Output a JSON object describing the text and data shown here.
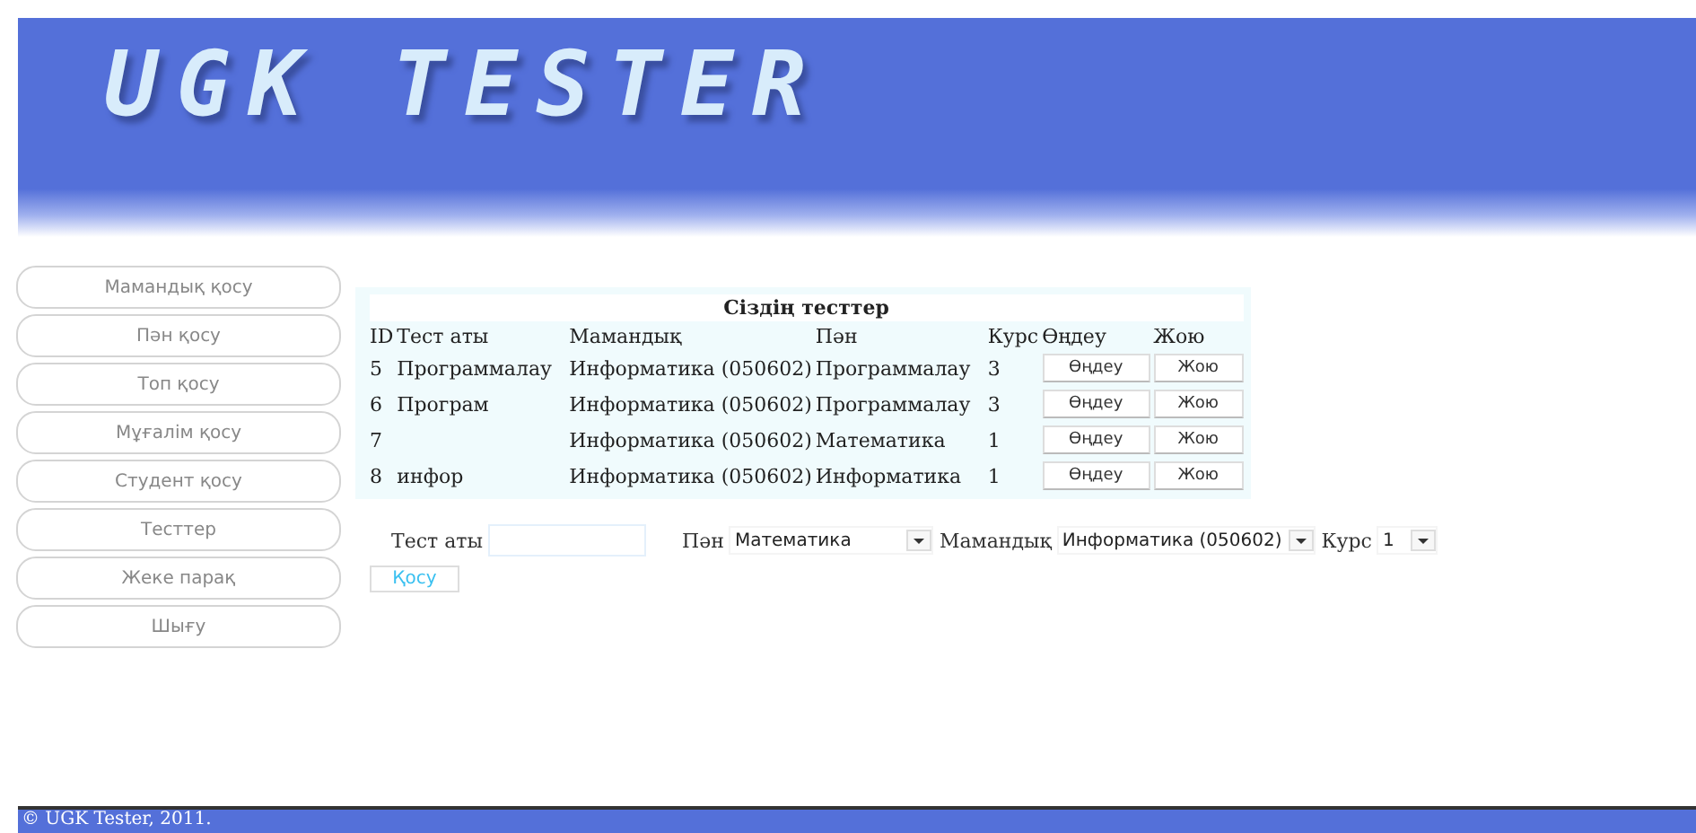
{
  "logo": {
    "text": "UGK TESTER"
  },
  "sidebar": {
    "items": [
      {
        "label": "Мамандық қосу"
      },
      {
        "label": "Пән қосу"
      },
      {
        "label": "Топ қосу"
      },
      {
        "label": "Мұғалім қосу"
      },
      {
        "label": "Студент қосу"
      },
      {
        "label": "Тесттер"
      },
      {
        "label": "Жеке парақ"
      },
      {
        "label": "Шығу"
      }
    ]
  },
  "table": {
    "title": "Сіздің тесттер",
    "columns": [
      "ID",
      "Тест аты",
      "Мамандық",
      "Пән",
      "Курс",
      "Өңдеу",
      "Жою"
    ],
    "rows": [
      {
        "id": "5",
        "name": "Программалау",
        "specialty": "Информатика (050602)",
        "subject": "Программалау",
        "course": "3",
        "edit": "Өңдеу",
        "delete": "Жою"
      },
      {
        "id": "6",
        "name": "Програм",
        "specialty": "Информатика (050602)",
        "subject": "Программалау",
        "course": "3",
        "edit": "Өңдеу",
        "delete": "Жою"
      },
      {
        "id": "7",
        "specialty": "Информатика (050602)",
        "subject": "Математика",
        "course": "1",
        "edit": "Өңдеу",
        "delete": "Жою"
      },
      {
        "id": "8",
        "name": "инфор",
        "specialty": "Информатика (050602)",
        "subject": "Информатика",
        "course": "1",
        "edit": "Өңдеу",
        "delete": "Жою"
      }
    ]
  },
  "form": {
    "test_name_label": "Тест аты",
    "subject_label": "Пән",
    "subject_value": "Математика",
    "specialty_label": "Мамандық",
    "specialty_value": "Информатика (050602)",
    "course_label": "Курс",
    "course_value": "1",
    "submit": "Қосу"
  },
  "footer": "© UGK Tester, 2011."
}
